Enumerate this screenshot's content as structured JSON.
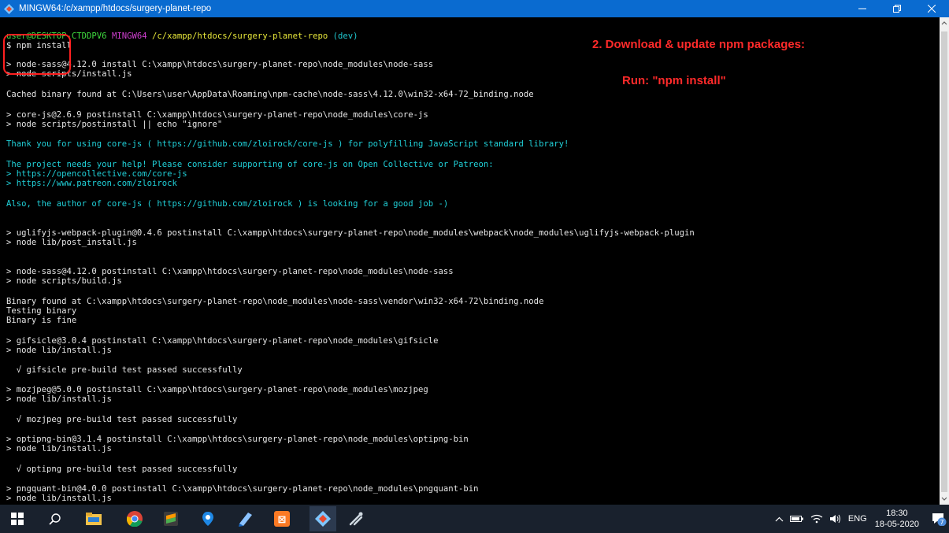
{
  "window": {
    "title": "MINGW64:/c/xampp/htdocs/surgery-planet-repo"
  },
  "terminal": {
    "prompt": {
      "user_host": "user@DESKTOP-CTDDPV6",
      "system": "MINGW64",
      "path": "/c/xampp/htdocs/surgery-planet-repo",
      "branch": "(dev)"
    },
    "command": "$ npm install",
    "lines": [
      "> node-sass@4.12.0 install C:\\xampp\\htdocs\\surgery-planet-repo\\node_modules\\node-sass",
      "> node scripts/install.js",
      "Cached binary found at C:\\Users\\user\\AppData\\Roaming\\npm-cache\\node-sass\\4.12.0\\win32-x64-72_binding.node",
      "> core-js@2.6.9 postinstall C:\\xampp\\htdocs\\surgery-planet-repo\\node_modules\\core-js",
      "> node scripts/postinstall || echo \"ignore\"",
      "Thank you for using core-js ( https://github.com/zloirock/core-js ) for polyfilling JavaScript standard library!",
      "The project needs your help! Please consider supporting of core-js on Open Collective or Patreon:",
      "> https://opencollective.com/core-js",
      "> https://www.patreon.com/zloirock",
      "Also, the author of core-js ( https://github.com/zloirock ) is looking for a good job -)",
      "> uglifyjs-webpack-plugin@0.4.6 postinstall C:\\xampp\\htdocs\\surgery-planet-repo\\node_modules\\webpack\\node_modules\\uglifyjs-webpack-plugin",
      "> node lib/post_install.js",
      "> node-sass@4.12.0 postinstall C:\\xampp\\htdocs\\surgery-planet-repo\\node_modules\\node-sass",
      "> node scripts/build.js",
      "Binary found at C:\\xampp\\htdocs\\surgery-planet-repo\\node_modules\\node-sass\\vendor\\win32-x64-72\\binding.node",
      "Testing binary",
      "Binary is fine",
      "> gifsicle@3.0.4 postinstall C:\\xampp\\htdocs\\surgery-planet-repo\\node_modules\\gifsicle",
      "> node lib/install.js",
      "  √ gifsicle pre-build test passed successfully",
      "> mozjpeg@5.0.0 postinstall C:\\xampp\\htdocs\\surgery-planet-repo\\node_modules\\mozjpeg",
      "> node lib/install.js",
      "  √ mozjpeg pre-build test passed successfully",
      "> optipng-bin@3.1.4 postinstall C:\\xampp\\htdocs\\surgery-planet-repo\\node_modules\\optipng-bin",
      "> node lib/install.js",
      "  √ optipng pre-build test passed successfully",
      "> pngquant-bin@4.0.0 postinstall C:\\xampp\\htdocs\\surgery-planet-repo\\node_modules\\pngquant-bin",
      "> node lib/install.js"
    ]
  },
  "annotations": {
    "step_title": "2. Download & update npm packages:",
    "run_hint": "Run: \"npm install\""
  },
  "taskbar": {
    "apps": [
      "windows-start",
      "search",
      "file-explorer",
      "chrome",
      "sublime-text",
      "maps",
      "notepad-plus",
      "xampp",
      "git-bash",
      "postman"
    ],
    "language": "ENG",
    "time": "18:30",
    "date": "18-05-2020",
    "notifications_count": "7"
  },
  "colors": {
    "titlebar": "#0a6bd0",
    "terminal_bg": "#000000",
    "taskbar_bg": "#19212d",
    "annotation": "#ff2a2a"
  }
}
